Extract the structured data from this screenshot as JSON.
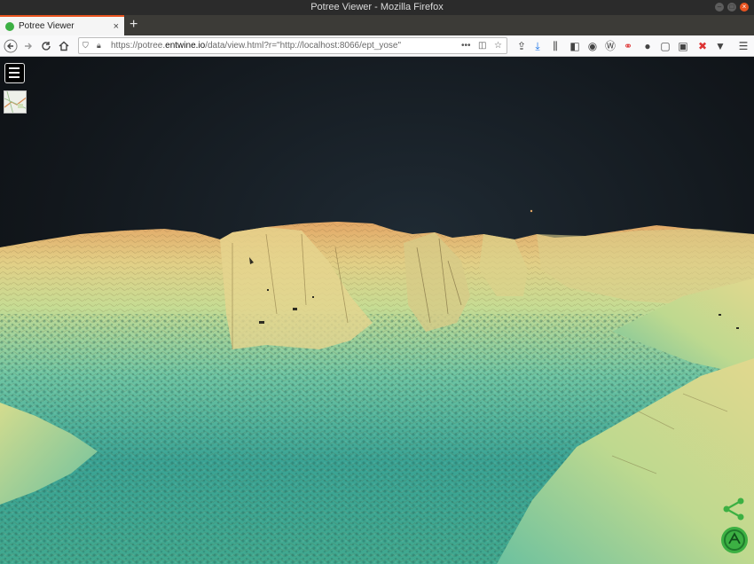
{
  "window": {
    "title": "Potree Viewer - Mozilla Firefox"
  },
  "tab": {
    "label": "Potree Viewer",
    "close": "×"
  },
  "newtab": "+",
  "address": {
    "prefix": "https://potree.",
    "domain": "entwine.io",
    "path": "/data/view.html?r=\"http://localhost:8066/ept_yose\""
  },
  "icons": {
    "back": "back-arrow-icon",
    "forward": "forward-arrow-icon",
    "reload": "reload-icon",
    "home": "home-icon",
    "menu": "hamburger-menu-icon",
    "share": "share-icon",
    "logo": "potree-logo-icon"
  },
  "colors": {
    "accent": "#e95420",
    "sky_top": "#0d1013",
    "terrain_low": "#2f9e92",
    "terrain_high": "#e3a766",
    "potree_green": "#3cb043"
  }
}
